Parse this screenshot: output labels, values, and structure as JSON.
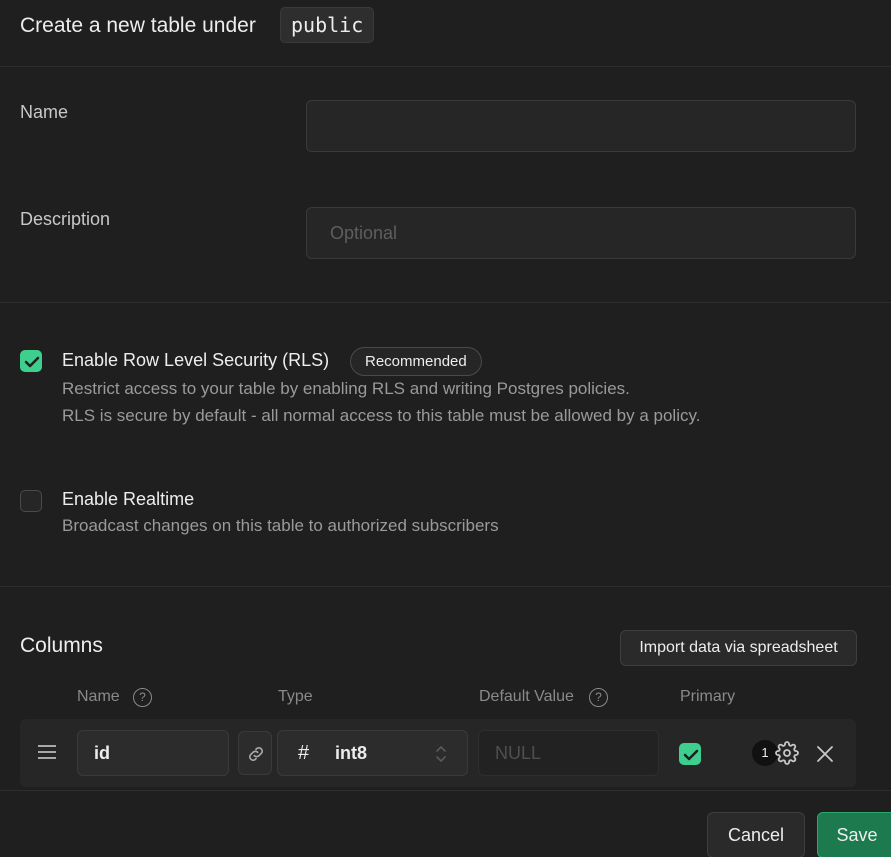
{
  "header": {
    "title": "Create a new table under",
    "schema": "public"
  },
  "fields": {
    "name_label": "Name",
    "name_value": "",
    "description_label": "Description",
    "description_placeholder": "Optional"
  },
  "rls": {
    "checked": true,
    "title": "Enable Row Level Security (RLS)",
    "badge": "Recommended",
    "desc_line1": "Restrict access to your table by enabling RLS and writing Postgres policies.",
    "desc_line2": "RLS is secure by default - all normal access to this table must be allowed by a policy."
  },
  "realtime": {
    "checked": false,
    "title": "Enable Realtime",
    "desc": "Broadcast changes on this table to authorized subscribers"
  },
  "columns": {
    "title": "Columns",
    "import_label": "Import data via spreadsheet",
    "headers": {
      "name": "Name",
      "type": "Type",
      "default_value": "Default Value",
      "primary": "Primary"
    },
    "help_glyph": "?",
    "rows": [
      {
        "name": "id",
        "type_icon": "#",
        "type": "int8",
        "default_placeholder": "NULL",
        "primary": true,
        "settings_count": "1"
      }
    ]
  },
  "footer": {
    "cancel_label": "Cancel",
    "save_label": "Save"
  },
  "colors": {
    "accent": "#3ecf8e",
    "save_bg": "#1c7a4e",
    "background": "#1f1f1f"
  }
}
